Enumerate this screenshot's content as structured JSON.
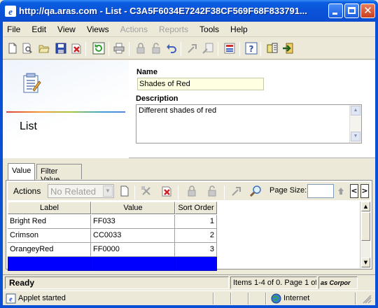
{
  "window": {
    "title": "http://qa.aras.com - List - C3A5F6034E7242F38CF569F68F833791...",
    "icon": "ie-browser-icon"
  },
  "menu": [
    "File",
    "Edit",
    "View",
    "Views",
    "Actions",
    "Reports",
    "Tools",
    "Help"
  ],
  "menu_disabled": [
    "Actions",
    "Reports"
  ],
  "toolbar_icons": [
    "new-icon",
    "print-preview-icon",
    "open-icon",
    "save-icon",
    "delete-icon",
    "refresh-icon",
    "print-icon",
    "lock-icon",
    "unlock-icon",
    "undo-icon",
    "promote-icon",
    "view-workflow-icon",
    "report-icon",
    "help-icon",
    "properties-icon",
    "exit-icon"
  ],
  "form": {
    "item_type": "List",
    "name_label": "Name",
    "name_value": "Shades of Red",
    "description_label": "Description",
    "description_value": "Different shades of red"
  },
  "tabs": [
    {
      "label": "Value",
      "active": true
    },
    {
      "label": "Filter Value",
      "active": false
    }
  ],
  "relationship_toolbar": {
    "actions_label": "Actions",
    "select_value": "No Related",
    "page_size_label": "Page Size:",
    "page_size_value": ""
  },
  "grid": {
    "columns": [
      "Label",
      "Value",
      "Sort Order"
    ],
    "rows": [
      {
        "label": "Bright Red",
        "value": "FF033",
        "sort_order": "1"
      },
      {
        "label": "Crimson",
        "value": "CC0033",
        "sort_order": "2"
      },
      {
        "label": "OrangeyRed",
        "value": "FF0000",
        "sort_order": "3"
      },
      {
        "label": "",
        "value": "",
        "sort_order": ""
      }
    ],
    "selected_row": 3,
    "selection_color": "#0000ff"
  },
  "statusbar": {
    "state": "Ready",
    "items": "Items 1-4 of 0. Page 1 of",
    "copyright": "as Corpor"
  },
  "browser_status": {
    "text": "Applet started",
    "zone": "Internet"
  }
}
